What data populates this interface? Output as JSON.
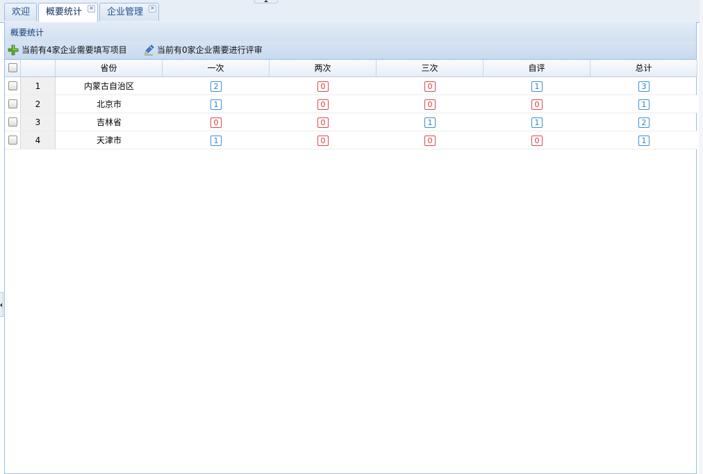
{
  "tabs": [
    {
      "label": "欢迎",
      "closable": false,
      "active": false
    },
    {
      "label": "概要统计",
      "closable": true,
      "active": true
    },
    {
      "label": "企业管理",
      "closable": true,
      "active": false
    }
  ],
  "panel": {
    "title": "概要统计",
    "toolbar": {
      "fill_label": "当前有4家企业需要填写项目",
      "fill_icon": "add-plus-icon",
      "review_label": "当前有0家企业需要进行评审",
      "review_icon": "pencil-icon"
    }
  },
  "grid": {
    "columns": [
      "省份",
      "一次",
      "两次",
      "三次",
      "自评",
      "总计"
    ],
    "rows": [
      {
        "num": "1",
        "province": "内蒙古自治区",
        "once": "2",
        "twice": "0",
        "thrice": "0",
        "self": "1",
        "total": "3"
      },
      {
        "num": "2",
        "province": "北京市",
        "once": "1",
        "twice": "0",
        "thrice": "0",
        "self": "0",
        "total": "1"
      },
      {
        "num": "3",
        "province": "吉林省",
        "once": "0",
        "twice": "0",
        "thrice": "1",
        "self": "1",
        "total": "2"
      },
      {
        "num": "4",
        "province": "天津市",
        "once": "1",
        "twice": "0",
        "thrice": "0",
        "self": "0",
        "total": "1"
      }
    ]
  },
  "colors": {
    "positive_badge": "#3a8fd4",
    "zero_badge": "#e0474c",
    "header_blue": "#99bbe8"
  }
}
